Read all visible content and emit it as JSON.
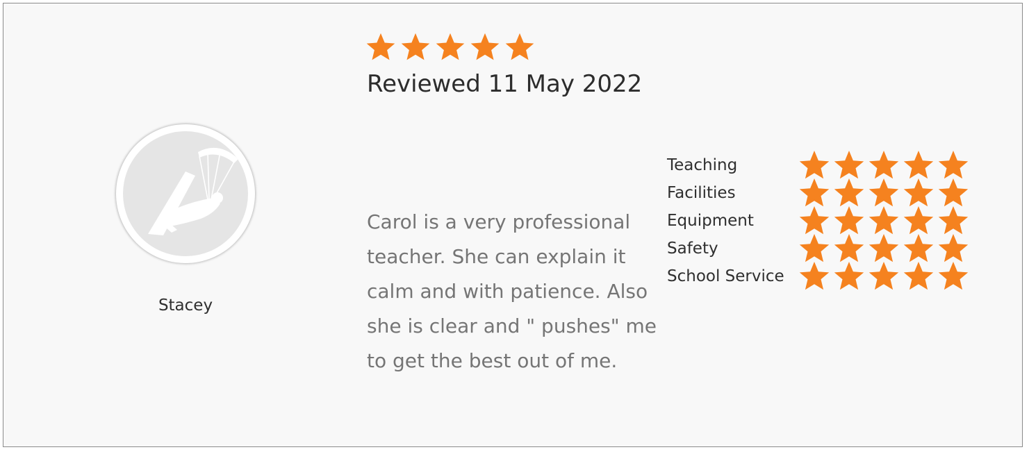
{
  "review": {
    "reviewer": {
      "name": "Stacey",
      "avatar_icon": "kitesurfer-icon"
    },
    "overall_rating": {
      "value": 5,
      "max": 5
    },
    "date_text": "Reviewed 11 May 2022",
    "text": "Carol is a very professional teacher. She can explain it calm and with patience. Also she is clear and \" pushes\" me to get the best out of me.",
    "categories": [
      {
        "label": "Teaching",
        "rating": 5,
        "max": 5
      },
      {
        "label": "Facilities",
        "rating": 5,
        "max": 5
      },
      {
        "label": "Equipment",
        "rating": 5,
        "max": 5
      },
      {
        "label": "Safety",
        "rating": 5,
        "max": 5
      },
      {
        "label": "School Service",
        "rating": 5,
        "max": 5
      }
    ]
  },
  "colors": {
    "star": "#f5821f",
    "card_background": "#f8f8f8",
    "card_border": "#8a8a8a",
    "avatar_background": "#e5e5e5"
  },
  "icons": {
    "star": "star-icon"
  }
}
